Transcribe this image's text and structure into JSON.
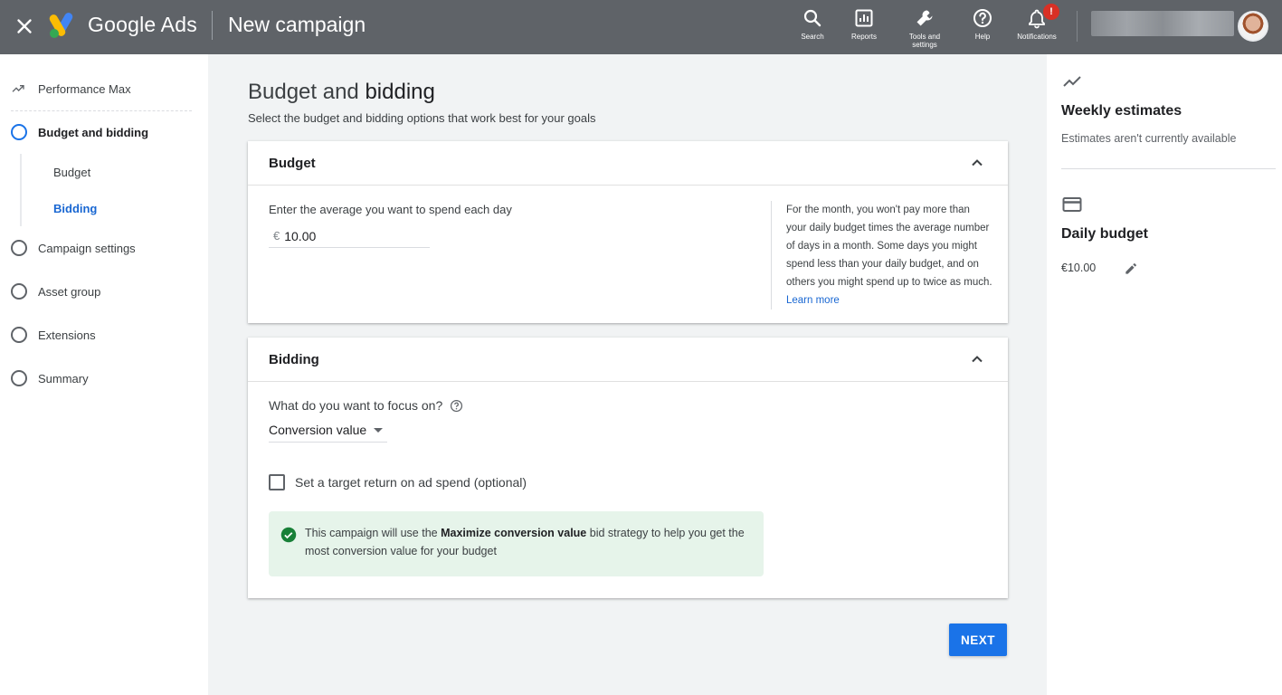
{
  "header": {
    "brand": "Google Ads",
    "title": "New campaign",
    "tools": [
      {
        "label": "Search",
        "icon": "search-icon"
      },
      {
        "label": "Reports",
        "icon": "reports-icon"
      },
      {
        "label": "Tools and settings",
        "icon": "wrench-icon"
      },
      {
        "label": "Help",
        "icon": "help-icon"
      },
      {
        "label": "Notifications",
        "icon": "bell-icon",
        "badge": "!"
      }
    ]
  },
  "sidebar": {
    "campaign_type": "Performance Max",
    "steps": [
      {
        "label": "Budget and bidding",
        "active": true
      },
      {
        "label": "Campaign settings"
      },
      {
        "label": "Asset group"
      },
      {
        "label": "Extensions"
      },
      {
        "label": "Summary"
      }
    ],
    "substeps": [
      "Budget",
      "Bidding"
    ]
  },
  "main": {
    "title_light": "Budget and ",
    "title_dark": "bidding",
    "subtitle": "Select the budget and bidding options that work best for your goals",
    "budget": {
      "heading": "Budget",
      "input_label": "Enter the average you want to spend each day",
      "currency": "€",
      "value": "10.00",
      "help": "For the month, you won't pay more than your daily budget times the average number of days in a month. Some days you might spend less than your daily budget, and on others you might spend up to twice as much.",
      "learn_more": "Learn more"
    },
    "bidding": {
      "heading": "Bidding",
      "focus_label": "What do you want to focus on?",
      "focus_value": "Conversion value",
      "troas_label": "Set a target return on ad spend (optional)",
      "info_pre": "This campaign will use the ",
      "info_strategy": "Maximize conversion value",
      "info_post": " bid strategy to help you get the most conversion value for your budget"
    },
    "next_label": "NEXT"
  },
  "right_panel": {
    "weekly_title": "Weekly estimates",
    "weekly_text": "Estimates aren't currently available",
    "daily_title": "Daily budget",
    "daily_amount": "€10.00"
  },
  "colors": {
    "topbar": "#5f6368",
    "accent": "#1a73e8",
    "success_bg": "#e6f4ea",
    "success_icon": "#188038",
    "badge": "#d93025"
  }
}
